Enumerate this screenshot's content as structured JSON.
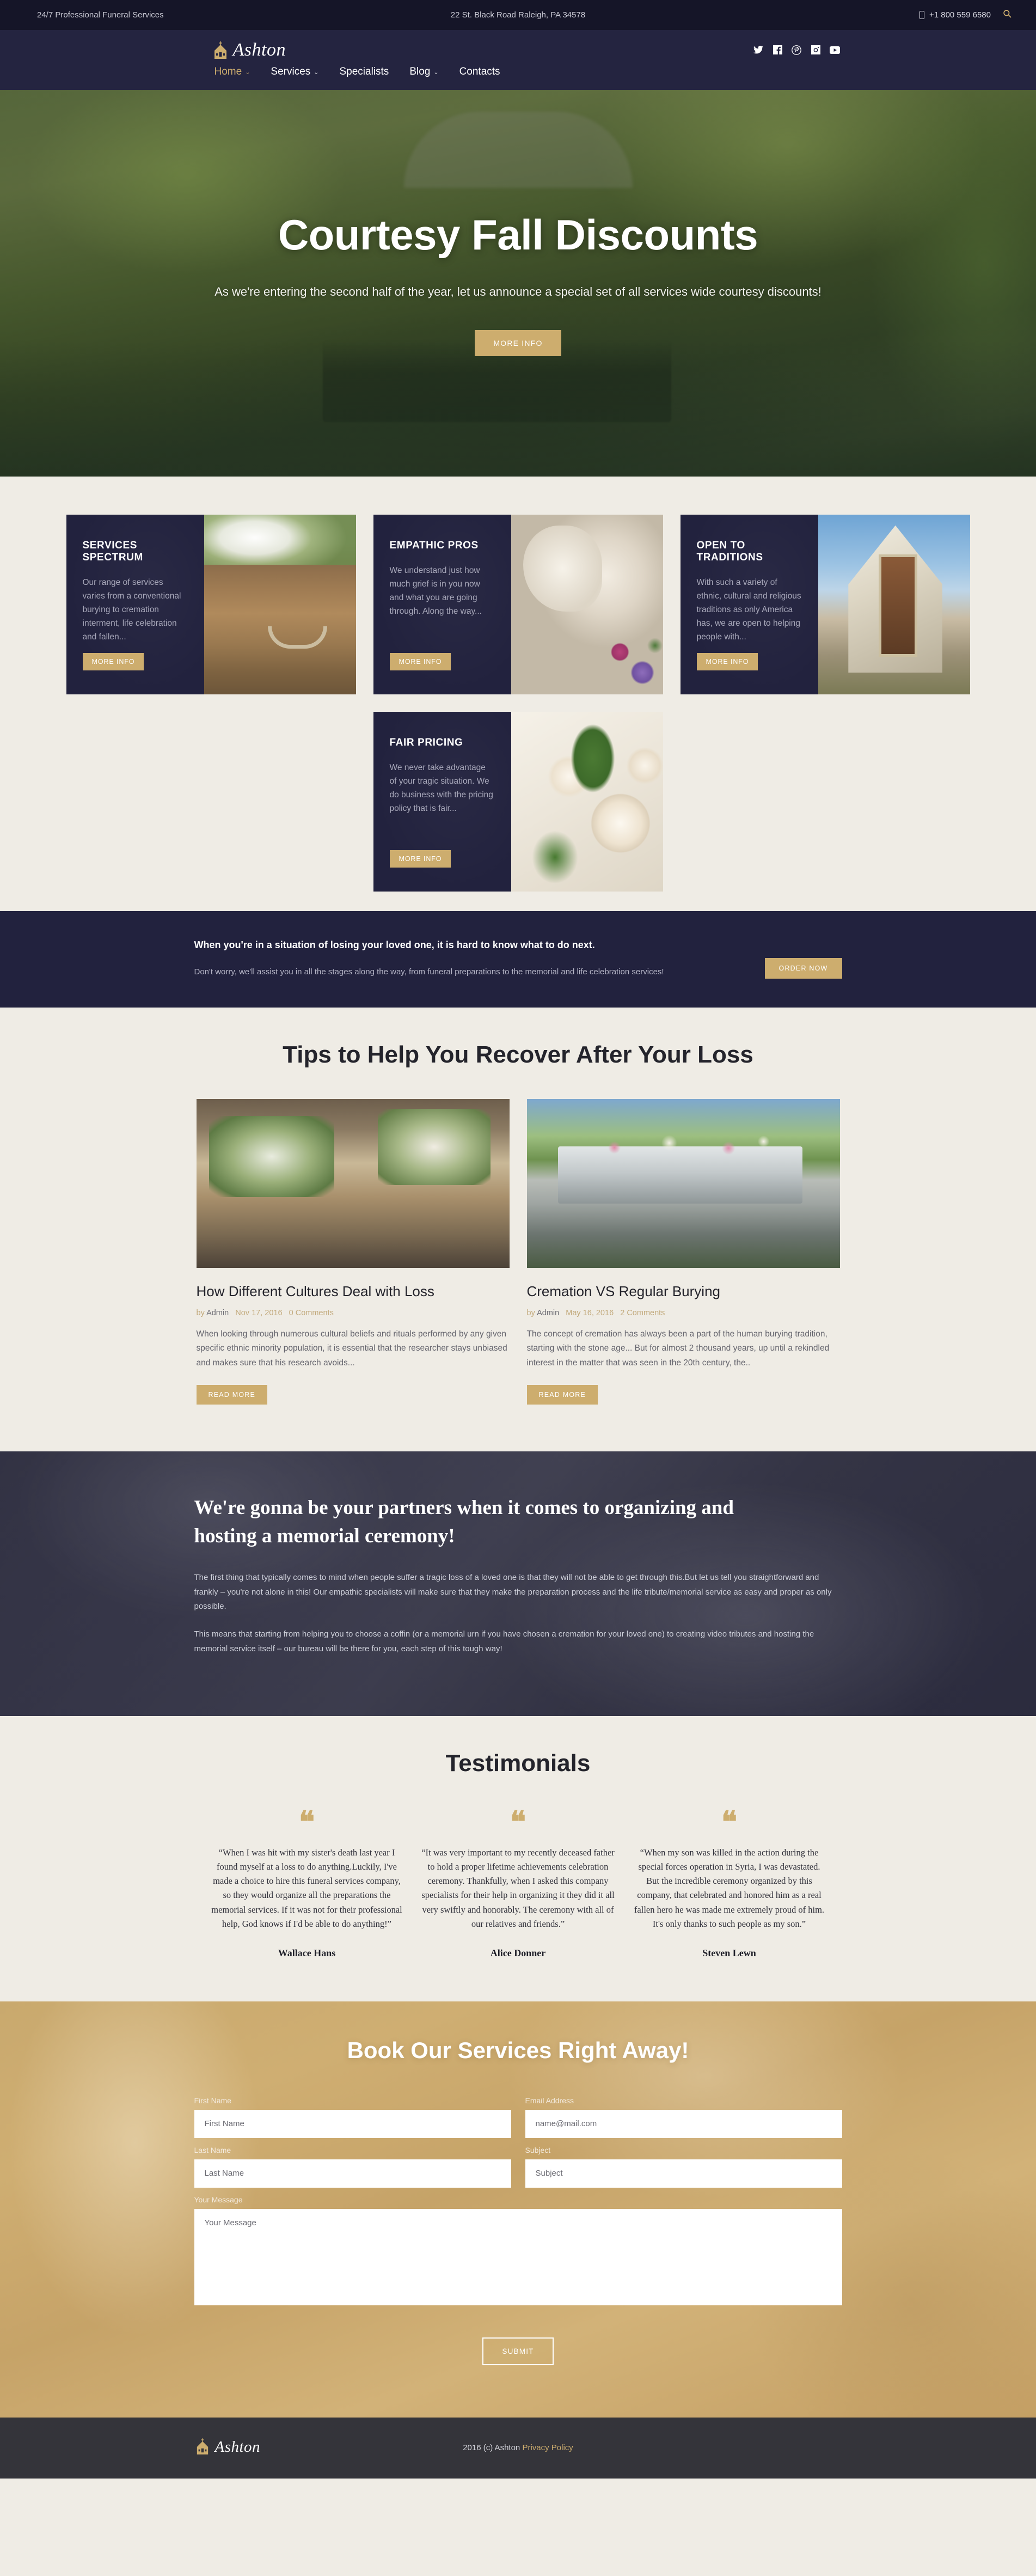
{
  "topbar": {
    "tagline": "24/7 Professional Funeral Services",
    "address": "22 St. Black Road Raleigh, PA 34578",
    "phone": "+1 800 559 6580",
    "search_icon": "search-icon"
  },
  "header": {
    "logo": "Ashton",
    "nav": [
      {
        "label": "Home",
        "caret": "⌄",
        "active": true
      },
      {
        "label": "Services",
        "caret": "⌄",
        "active": false
      },
      {
        "label": "Specialists",
        "caret": "",
        "active": false
      },
      {
        "label": "Blog",
        "caret": "⌄",
        "active": false
      },
      {
        "label": "Contacts",
        "caret": "",
        "active": false
      }
    ],
    "social": [
      {
        "name": "twitter-icon",
        "glyph": "🐦"
      },
      {
        "name": "facebook-icon",
        "glyph": "f"
      },
      {
        "name": "pinterest-icon",
        "glyph": "Ⓟ"
      },
      {
        "name": "instagram-icon",
        "glyph": "◎"
      },
      {
        "name": "youtube-icon",
        "glyph": "▶"
      }
    ]
  },
  "hero": {
    "title": "Courtesy Fall Discounts",
    "subtitle": "As we're entering the second half of the year, let us announce a special set of all services wide courtesy discounts!",
    "button": "MORE INFO"
  },
  "services": {
    "cards": [
      {
        "title": "SERVICES SPECTRUM",
        "text": "Our range of services varies from a conventional burying to cremation interment, life celebration and fallen...",
        "button": "MORE INFO",
        "image": "coffin-with-white-flowers"
      },
      {
        "title": "EMPATHIC PROS",
        "text": "We understand just how much grief is in you now and what you are going through. Along the way...",
        "button": "MORE INFO",
        "image": "stone-angel-statue"
      },
      {
        "title": "OPEN TO TRADITIONS",
        "text": "With such a variety of ethnic, cultural and religious traditions as only America has, we are open to helping people with...",
        "button": "MORE INFO",
        "image": "church-building"
      },
      {
        "title": "FAIR PRICING",
        "text": "We never take advantage of your tragic situation. We do business with the pricing policy that is fair...",
        "button": "MORE INFO",
        "image": "white-roses"
      }
    ]
  },
  "cta": {
    "heading": "When you're in a situation of losing your loved one, it is hard to know what to do next.",
    "text": "Don't worry, we'll assist you in all the stages along the way, from funeral preparations to the memorial and life celebration services!",
    "button": "ORDER NOW"
  },
  "blog": {
    "title": "Tips to Help You Recover After Your Loss",
    "posts": [
      {
        "title": "How Different Cultures Deal with Loss",
        "author_prefix": "by",
        "author": "Admin",
        "date": "Nov 17, 2016",
        "comments": "0 Comments",
        "excerpt": "When looking through numerous cultural beliefs and rituals performed by any given specific ethnic minority population, it is essential that the researcher stays unbiased and makes sure that his research avoids...",
        "button": "READ MORE",
        "image": "flower-shop-interior"
      },
      {
        "title": "Cremation VS Regular Burying",
        "author_prefix": "by",
        "author": "Admin",
        "date": "May 16, 2016",
        "comments": "2 Comments",
        "excerpt": "The concept of cremation has always been a part of the human burying tradition, starting with the stone age... But for almost 2 thousand years, up until a rekindled interest in the matter that was seen in the 20th century, the..",
        "button": "READ MORE",
        "image": "silver-casket-with-flowers"
      }
    ]
  },
  "partners": {
    "heading": "We're gonna be your partners when it comes to organizing and hosting a memorial ceremony!",
    "paragraph1": "The first thing that typically comes to mind when people suffer a tragic loss of a loved one is that they will not be able to get through this.But let us tell you straightforward and frankly – you're not alone in this! Our empathic specialists will make sure that they make the preparation process and the life tribute/memorial service as easy and proper as only possible.",
    "paragraph2": "This means that starting from helping you to choose a coffin (or a memorial urn if you have chosen a cremation for your loved one) to creating video tributes and hosting the memorial service itself – our bureau will be there for you, each step of this tough way!"
  },
  "testimonials": {
    "title": "Testimonials",
    "quote_icon": "“",
    "items": [
      {
        "text": "“When I was hit with my sister's death last year I found myself at a loss to do anything.Luckily, I've made a choice to hire this funeral services company, so they would organize all the preparations the memorial services. If it was not for their professional help, God knows if I'd be able to do anything!”",
        "name": "Wallace Hans"
      },
      {
        "text": "“It was very important to my recently deceased father to hold a proper lifetime achievements celebration ceremony. Thankfully, when I asked this company specialists for their help in organizing it they did it all very swiftly and honorably. The ceremony with all of our relatives and friends.”",
        "name": "Alice Donner"
      },
      {
        "text": "“When my son was killed in the action during the special forces operation in Syria, I was devastated. But the incredible ceremony organized by this company, that celebrated and honored him as a real fallen hero he was made me extremely proud of him. It's only thanks to such people as my son.”",
        "name": "Steven Lewn"
      }
    ]
  },
  "book": {
    "title": "Book Our Services Right Away!",
    "fields": {
      "first_name_label": "First Name",
      "first_name_placeholder": "First Name",
      "email_label": "Email Address",
      "email_placeholder": "name@mail.com",
      "last_name_label": "Last Name",
      "last_name_placeholder": "Last Name",
      "subject_label": "Subject",
      "subject_placeholder": "Subject",
      "message_label": "Your Message",
      "message_placeholder": "Your Message"
    },
    "submit": "SUBMIT"
  },
  "footer": {
    "logo": "Ashton",
    "copyright": "2016 (c) Ashton",
    "privacy": "Privacy Policy"
  }
}
